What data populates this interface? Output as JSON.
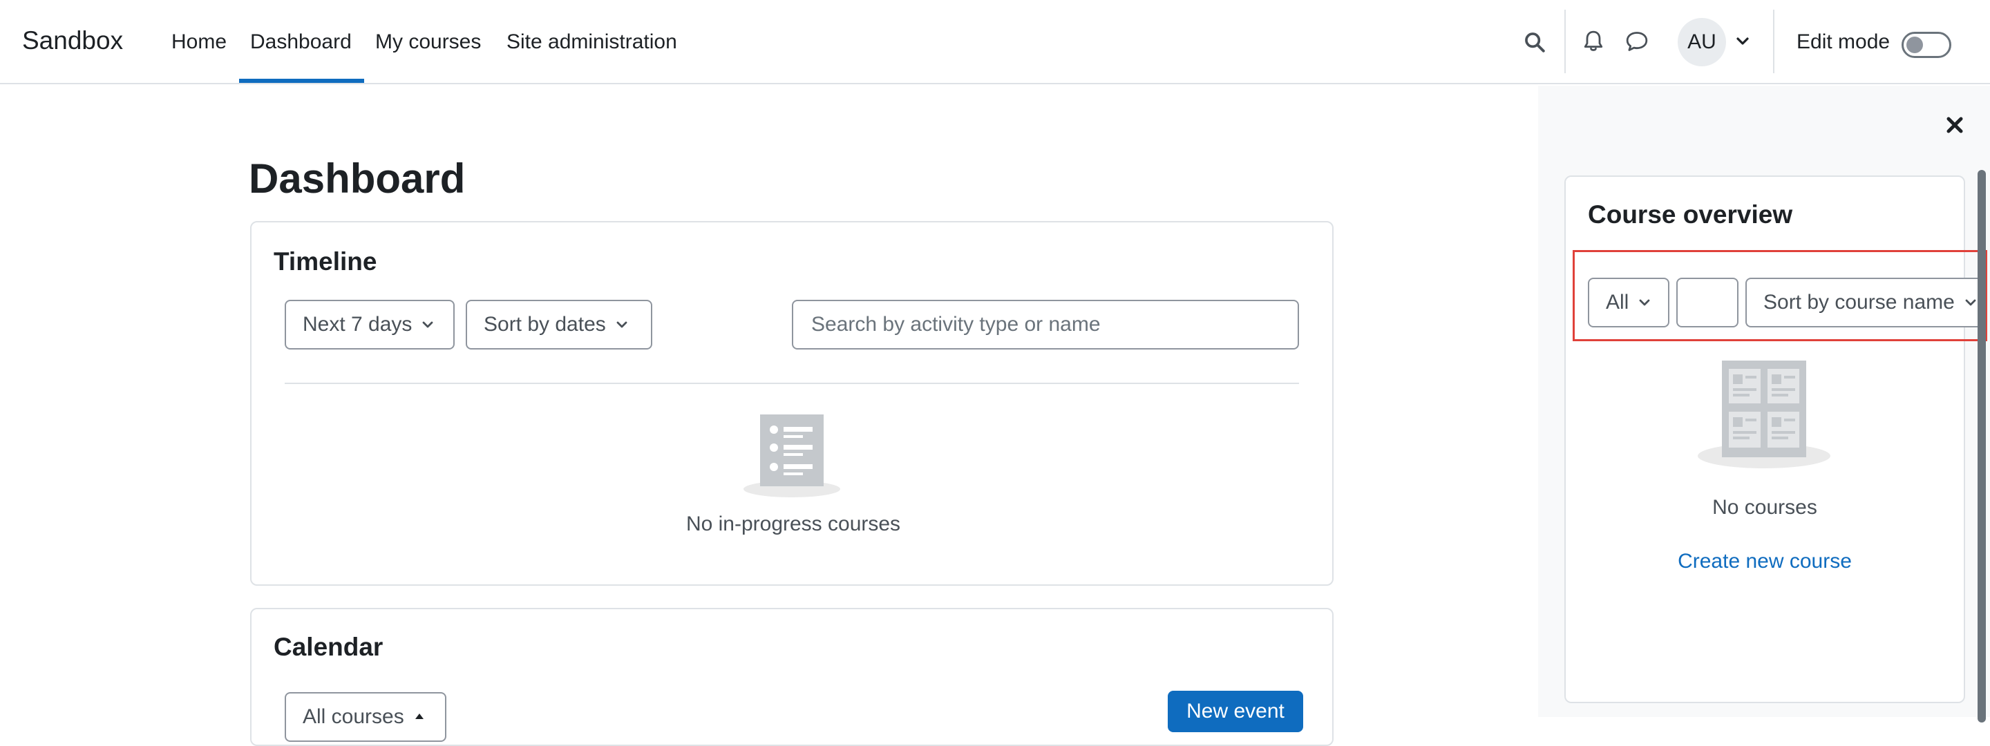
{
  "navbar": {
    "brand": "Sandbox",
    "items": [
      {
        "label": "Home"
      },
      {
        "label": "Dashboard",
        "active": true
      },
      {
        "label": "My courses"
      },
      {
        "label": "Site administration"
      }
    ],
    "icons": [
      "search-icon",
      "bell-icon",
      "chat-icon",
      "chevron-down-icon"
    ],
    "avatar_initials": "AU",
    "edit_mode_label": "Edit mode",
    "edit_mode_on": false,
    "accent_color": "#0f6cbf"
  },
  "page": {
    "title": "Dashboard"
  },
  "timeline": {
    "title": "Timeline",
    "range_select": "Next 7 days",
    "sort_select": "Sort by dates",
    "search_placeholder": "Search by activity type or name",
    "empty_text": "No in-progress courses"
  },
  "calendar": {
    "title": "Calendar",
    "course_select": "All courses",
    "new_event_button": "New event"
  },
  "drawer": {
    "close_icon": "close-icon",
    "course_overview": {
      "title": "Course overview",
      "filter_select": "All",
      "search_value": "",
      "sort_select": "Sort by course name",
      "empty_text": "No courses",
      "create_link": "Create new course",
      "highlight_color": "#e0413a"
    }
  }
}
